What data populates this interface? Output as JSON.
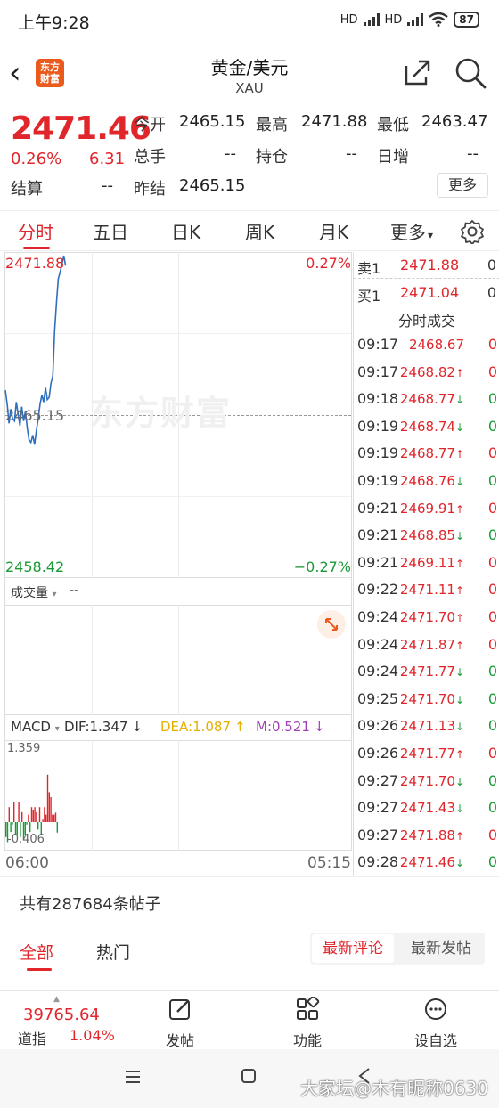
{
  "status_bar": {
    "time": "上午9:28",
    "signal1": "HD",
    "signal2": "HD",
    "battery": "87"
  },
  "header": {
    "logo_text": "东方财富",
    "title": "黄金/美元",
    "subtitle": "XAU"
  },
  "quote": {
    "price": "2471.46",
    "change_pct": "0.26%",
    "change": "6.31",
    "fields": [
      {
        "label": "今开",
        "value": "2465.15",
        "color": "#222222"
      },
      {
        "label": "最高",
        "value": "2471.88",
        "color": "#e0262b"
      },
      {
        "label": "最低",
        "value": "2463.47",
        "color": "#1a9a36"
      },
      {
        "label": "总手",
        "value": "--",
        "color": "#222222"
      },
      {
        "label": "持仓",
        "value": "--",
        "color": "#222222"
      },
      {
        "label": "日增",
        "value": "--",
        "color": "#222222"
      },
      {
        "label": "结算",
        "value": "--",
        "color": "#222222"
      },
      {
        "label": "昨结",
        "value": "2465.15",
        "color": "#222222"
      }
    ],
    "more": "更多"
  },
  "tabs": [
    "分时",
    "五日",
    "日K",
    "周K",
    "月K",
    "更多"
  ],
  "tab_more_arrow": "▾",
  "chart": {
    "price_high": "2471.88",
    "price_mid": "2465.15",
    "price_low": "2458.42",
    "pct_high": "0.27%",
    "pct_low": "−0.27%",
    "watermark": "东方财富",
    "volume_label": "成交量",
    "volume_value": "--",
    "macd_label": "MACD",
    "dif": "DIF:1.347",
    "dif_arrow": "↓",
    "dea": "DEA:1.087",
    "dea_arrow": "↑",
    "m": "M:0.521",
    "m_arrow": "↓",
    "macd_high": "1.359",
    "macd_low": "-0.406",
    "time_start": "06:00",
    "time_end": "05:15",
    "colors": {
      "up": "#e0262b",
      "down": "#1a9a36",
      "line": "#2f6fbf",
      "dea": "#e3b000",
      "m": "#a23fb8"
    }
  },
  "chart_data": {
    "type": "line",
    "title": "",
    "xlabel": "",
    "ylabel": "",
    "ylim": [
      2458.42,
      2471.88
    ],
    "series": [
      {
        "values": [
          2466.2,
          2465.6,
          2464.8,
          2465.4,
          2465.0,
          2464.9,
          2465.7,
          2465.2,
          2464.7,
          2465.5,
          2464.9,
          2465.3,
          2464.6,
          2464.1,
          2464.0,
          2464.3,
          2463.9,
          2464.5,
          2465.0,
          2465.6,
          2466.0,
          2465.7,
          2466.3,
          2465.8,
          2465.9,
          2466.5,
          2466.8,
          2468.7,
          2469.9,
          2470.9,
          2471.2,
          2471.5,
          2471.88,
          2471.46
        ]
      }
    ]
  },
  "orderbook": [
    {
      "side": "卖1",
      "price": "2471.88",
      "volume": "0"
    },
    {
      "side": "买1",
      "price": "2471.04",
      "volume": "0"
    }
  ],
  "ticks_title": "分时成交",
  "ticks": [
    {
      "time": "09:17",
      "price": "2468.67",
      "dir": "",
      "volume": "0"
    },
    {
      "time": "09:17",
      "price": "2468.82",
      "dir": "up",
      "volume": "0"
    },
    {
      "time": "09:18",
      "price": "2468.77",
      "dir": "down",
      "volume": "0"
    },
    {
      "time": "09:19",
      "price": "2468.74",
      "dir": "down",
      "volume": "0"
    },
    {
      "time": "09:19",
      "price": "2468.77",
      "dir": "up",
      "volume": "0"
    },
    {
      "time": "09:19",
      "price": "2468.76",
      "dir": "down",
      "volume": "0"
    },
    {
      "time": "09:21",
      "price": "2469.91",
      "dir": "up",
      "volume": "0"
    },
    {
      "time": "09:21",
      "price": "2468.85",
      "dir": "down",
      "volume": "0"
    },
    {
      "time": "09:21",
      "price": "2469.11",
      "dir": "up",
      "volume": "0"
    },
    {
      "time": "09:22",
      "price": "2471.11",
      "dir": "up",
      "volume": "0"
    },
    {
      "time": "09:24",
      "price": "2471.70",
      "dir": "up",
      "volume": "0"
    },
    {
      "time": "09:24",
      "price": "2471.87",
      "dir": "up",
      "volume": "0"
    },
    {
      "time": "09:24",
      "price": "2471.77",
      "dir": "down",
      "volume": "0"
    },
    {
      "time": "09:25",
      "price": "2471.70",
      "dir": "down",
      "volume": "0"
    },
    {
      "time": "09:26",
      "price": "2471.13",
      "dir": "down",
      "volume": "0"
    },
    {
      "time": "09:26",
      "price": "2471.77",
      "dir": "up",
      "volume": "0"
    },
    {
      "time": "09:27",
      "price": "2471.70",
      "dir": "down",
      "volume": "0"
    },
    {
      "time": "09:27",
      "price": "2471.43",
      "dir": "down",
      "volume": "0"
    },
    {
      "time": "09:27",
      "price": "2471.88",
      "dir": "up",
      "volume": "0"
    },
    {
      "time": "09:28",
      "price": "2471.46",
      "dir": "down",
      "volume": "0"
    }
  ],
  "posts": {
    "count_text": "共有287684条帖子",
    "tabs": [
      "全部",
      "热门"
    ],
    "sort": [
      "最新评论",
      "最新发帖"
    ]
  },
  "bottom_bar": {
    "index_value": "39765.64",
    "index_name": "道指",
    "index_change": "1.04%",
    "items": [
      {
        "label": "发帖",
        "icon": "edit-icon"
      },
      {
        "label": "功能",
        "icon": "grid-icon"
      },
      {
        "label": "设自选",
        "icon": "more-circle-icon"
      }
    ]
  },
  "nav": {
    "watermark": "大家坛@木有昵称0630"
  }
}
